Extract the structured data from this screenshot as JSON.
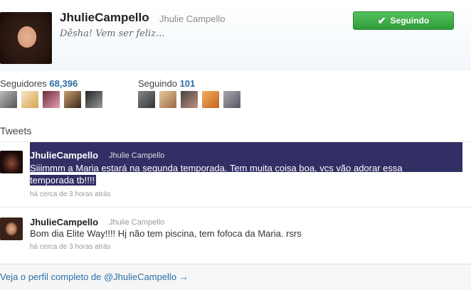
{
  "profile": {
    "name": "JhulieCampello",
    "handle": "Jhulie Campello",
    "bio": "Dêsha! Vem ser feliz...",
    "follow_button": "Seguindo"
  },
  "stats": {
    "followers_label": "Seguidores",
    "followers_count": "68,396",
    "following_label": "Seguindo",
    "following_count": "101"
  },
  "tweets_title": "Tweets",
  "tweets": [
    {
      "name": "JhulieCampello",
      "handle": "Jhulie Campello",
      "line1": "Siiimmm a Maria estará na segunda temporada. Tem muita coisa boa, vcs vão adorar essa",
      "line2": "temporada tb!!!!",
      "time": "há cerca de 3 horas atrás"
    },
    {
      "name": "JhulieCampello",
      "handle": "Jhulie Campello",
      "line1": "Bom dia Elite Way!!!! Hj não tem piscina, tem fofoca da Maria. rsrs",
      "time": "há cerca de 3 horas atrás"
    }
  ],
  "footer_link": "Veja o perfil completo de @JhulieCampello →",
  "colors": {
    "follow_green": "#3aa845",
    "link_blue": "#2a6fa8",
    "selection_bg": "#312f64"
  }
}
